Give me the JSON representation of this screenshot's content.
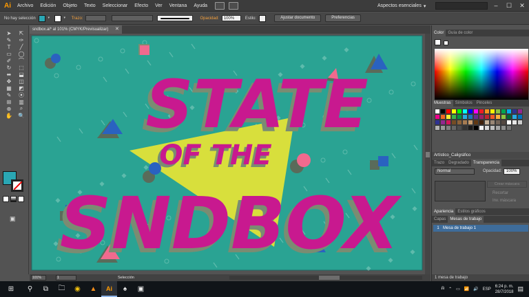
{
  "app": {
    "logo": "Ai"
  },
  "menu": [
    "Archivo",
    "Edición",
    "Objeto",
    "Texto",
    "Seleccionar",
    "Efecto",
    "Ver",
    "Ventana",
    "Ayuda"
  ],
  "workspace": {
    "label": "Aspectos esenciales",
    "chevron": "▾"
  },
  "window_controls": {
    "minimize": "–",
    "maximize": "☐",
    "close": "✕"
  },
  "control_bar": {
    "selection_status": "No hay selección",
    "stroke_label": "Trazo:",
    "opacity_label": "Opacidad:",
    "opacity_value": "100%",
    "style_label": "Estilo:",
    "document_button": "Ajustar documento",
    "preferences_button": "Preferencias",
    "fill_color": "#2aa7b4"
  },
  "document": {
    "tab_title": "sndbox.ai* al 101% (CMYK/Previsualizar)",
    "close": "✕",
    "zoom": "101%",
    "page": "1",
    "status_mode": "Selección"
  },
  "artwork": {
    "line1": "STATE",
    "line2": "OF THE",
    "line3": "SNDBOX",
    "background": "#2aa393",
    "triangle_color": "#d8df3c",
    "letter_color": "#c8198f",
    "shadow_color": "#7a8c72"
  },
  "tools": [
    "➤",
    "⇱",
    "✎",
    "✑",
    "T",
    "╱",
    "▭",
    "◯",
    "✐",
    "⌒",
    "↻",
    "⬚",
    "⬌",
    "⬓",
    "✥",
    "◫",
    "▦",
    "◩",
    "✎",
    "⦿",
    "⊞",
    "▥",
    "⊕",
    "⌕",
    "✋",
    "🔍"
  ],
  "panels": {
    "color_tabs": [
      "Color",
      "Guía de color"
    ],
    "swatch_tabs": [
      "Muestras",
      "Símbolos",
      "Pinceles"
    ],
    "brush_lib_label": "Artístico_Caligráfico",
    "transparency_tabs": [
      "Trazo",
      "Degradado",
      "Transparencia"
    ],
    "blend_mode": "Normal",
    "opacity_label": "Opacidad:",
    "opacity_value": "100%",
    "mask_button": "Crear máscara",
    "clip_label": "Recortar",
    "invert_label": "Inv. máscara",
    "appearance_tabs": [
      "Apariencia",
      "Estilos gráficos"
    ],
    "layers_tabs": [
      "Capas",
      "Mesas de trabajo"
    ],
    "layer_row": {
      "index": "1",
      "name": "Mesa de trabajo 1"
    },
    "footer": "1 mesa de trabajo"
  },
  "swatches": [
    "#ffffff",
    "#000000",
    "#ff0000",
    "#ffff00",
    "#00ff00",
    "#00ffff",
    "#0000ff",
    "#ff00ff",
    "#ed1c24",
    "#f7941d",
    "#fff200",
    "#8dc63f",
    "#00a651",
    "#00aeef",
    "#2e3192",
    "#92278f",
    "#ec008c",
    "#f26522",
    "#f9ed32",
    "#39b54a",
    "#009444",
    "#27aae1",
    "#1c75bc",
    "#662d91",
    "#9e1f63",
    "#c1272d",
    "#f15a24",
    "#fbb03b",
    "#8cc63f",
    "#006837",
    "#29abe2",
    "#0071bc",
    "#2e3192",
    "#93278f",
    "#d4145a",
    "#754c24",
    "#8c6239",
    "#a67c52",
    "#c69c6d",
    "#603813",
    "#42210b",
    "#c7b299",
    "#998675",
    "#736357",
    "#534741",
    "#ffffff",
    "#e6e6e6",
    "#cccccc",
    "#b3b3b3",
    "#999999",
    "#808080",
    "#666666",
    "#4d4d4d",
    "#333333",
    "#1a1a1a",
    "#000000",
    "#f2f2f2",
    "#d9d9d9",
    "#bfbfbf",
    "#a6a6a6",
    "#8c8c8c",
    "#737373"
  ],
  "taskbar": {
    "start": "⊞",
    "search": "⚲",
    "taskview": "⧉",
    "apps": [
      "🗀",
      "◉",
      "▲",
      "Ai",
      "♠",
      "▣"
    ],
    "tray_icons": [
      "ᕱ",
      "⌃",
      "▭",
      "📶",
      "🔊"
    ],
    "language": "ESP",
    "time": "6:24 p. m.",
    "date": "28/7/2018",
    "notification": "▤"
  }
}
